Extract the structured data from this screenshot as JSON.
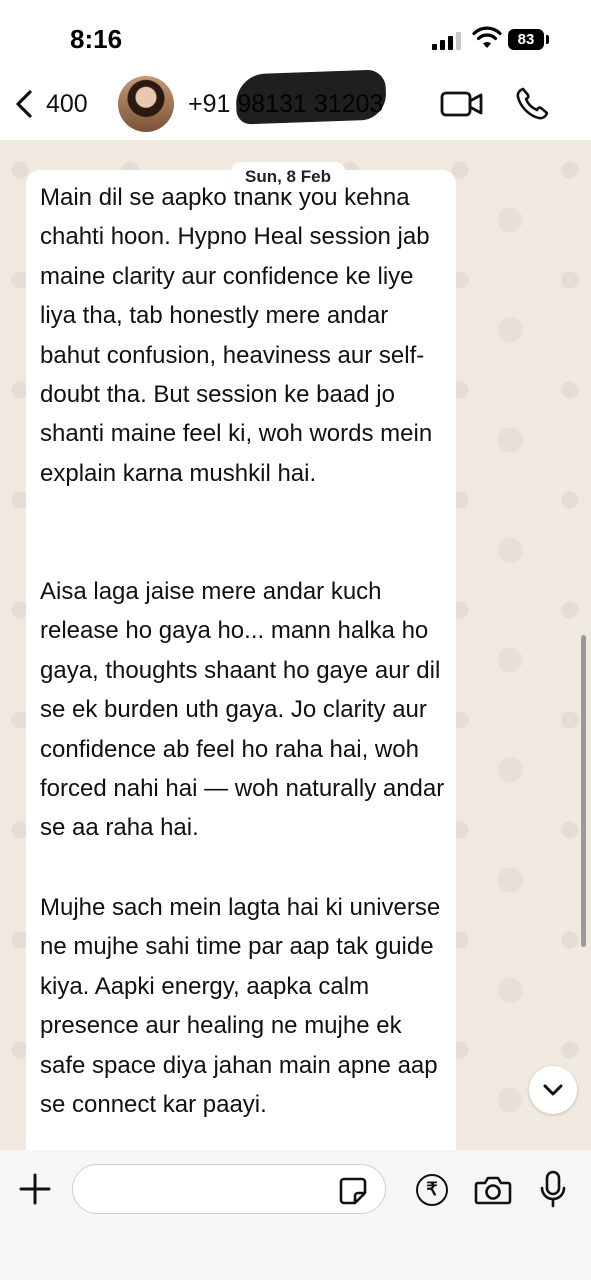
{
  "status_bar": {
    "time": "8:16",
    "battery": "83"
  },
  "header": {
    "back_count": "400",
    "contact_number": "+91 98131 31203"
  },
  "chat": {
    "date_chip": "Sun, 8 Feb",
    "message_paragraphs": [
      "Main dil se aapko thank you kehna chahti hoon. Hypno Heal session jab maine clarity aur confidence ke liye liya tha, tab honestly mere andar bahut confusion, heaviness aur self-doubt tha. But session ke baad jo shanti maine feel ki, woh words mein explain karna mushkil hai.",
      "Aisa laga jaise mere andar kuch release ho gaya ho... mann halka ho gaya, thoughts shaant ho gaye aur dil se ek burden uth gaya. Jo clarity aur confidence ab feel ho raha hai, woh forced nahi hai — woh naturally andar se aa raha hai.",
      "Mujhe sach mein lagta hai ki universe ne mujhe sahi time par aap tak guide kiya. Aapki energy, aapka calm presence aur healing ne mujhe ek safe space diya jahan main apne aap se connect kar paayi."
    ]
  },
  "input_bar": {
    "message_placeholder": ""
  },
  "icons": {
    "back": "chevron-left-icon",
    "video": "video-camera-icon",
    "phone": "phone-icon",
    "plus": "plus-icon",
    "sticker": "sticker-icon",
    "payment": "rupee-icon",
    "camera": "camera-icon",
    "mic": "microphone-icon",
    "scroll_down": "chevron-down-icon"
  },
  "colors": {
    "chat_background": "#efe9e0",
    "bubble": "#ffffff",
    "text": "#111111"
  }
}
